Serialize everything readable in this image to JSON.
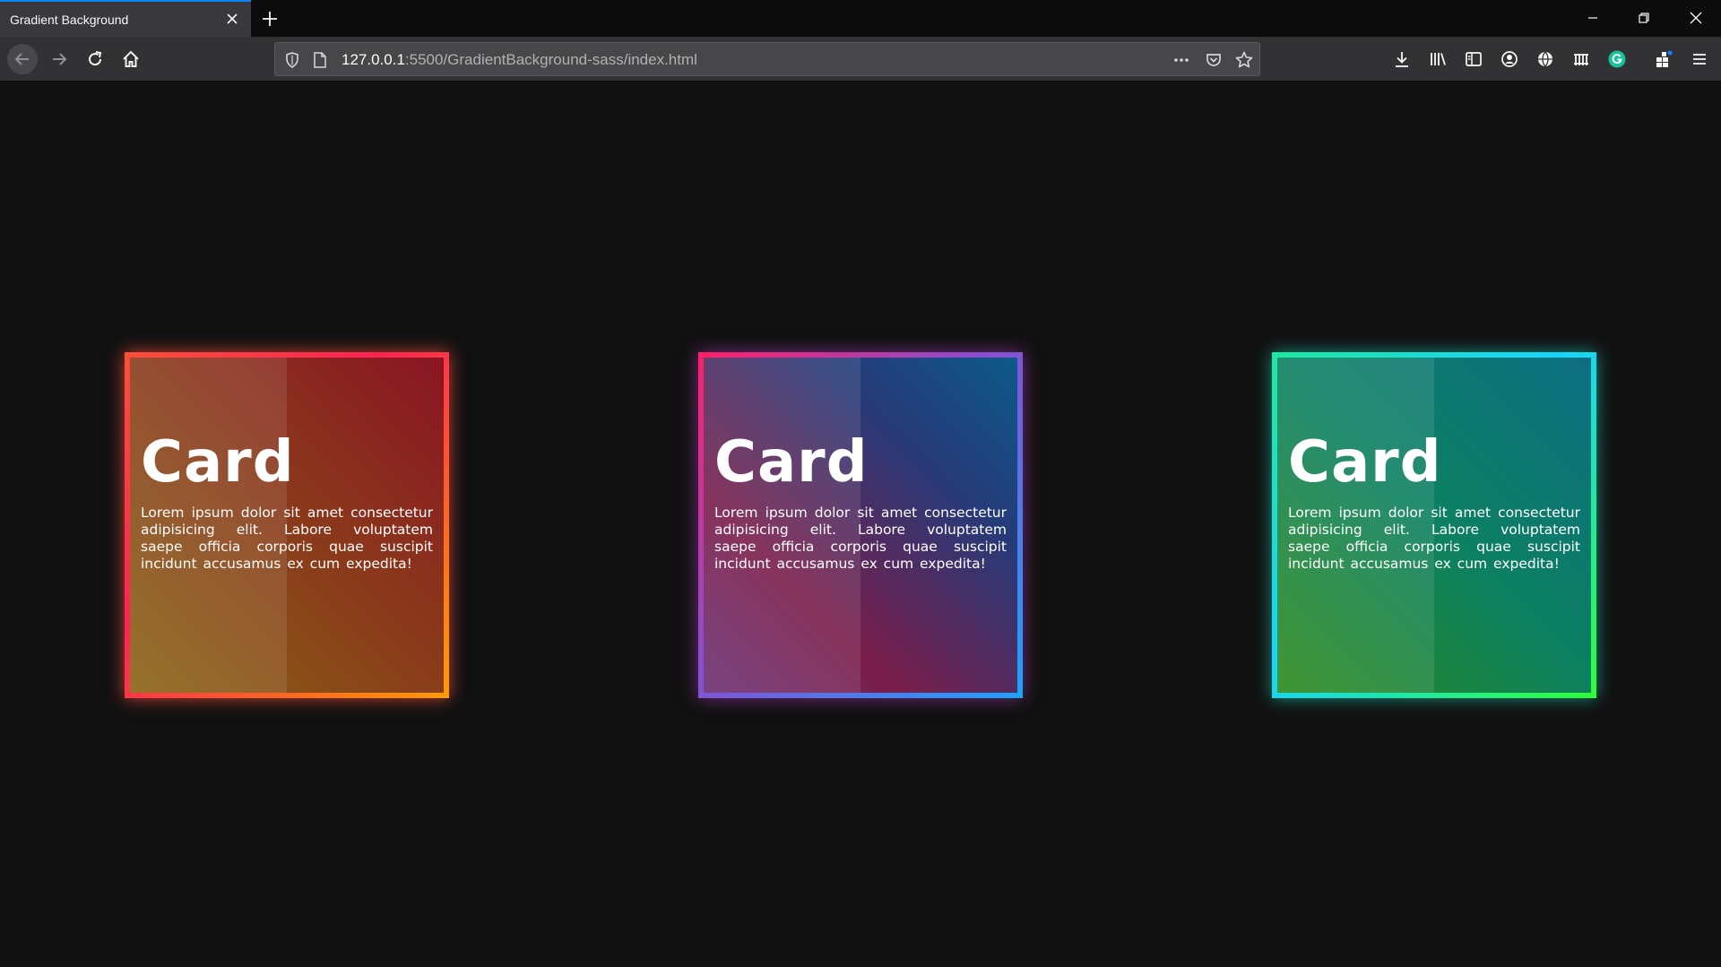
{
  "browser": {
    "tab_title": "Gradient Background",
    "url_host": "127.0.0.1",
    "url_path": ":5500/GradientBackground-sass/index.html",
    "accent_color": "#0a84ff"
  },
  "icons": {
    "tab_close": "close-icon",
    "new_tab": "plus-icon",
    "back": "arrow-left-icon",
    "forward": "arrow-right-icon",
    "reload": "reload-icon",
    "home": "home-icon",
    "shield": "shield-icon",
    "page": "page-icon",
    "more": "more-dots-icon",
    "pocket": "pocket-icon",
    "bookmark": "star-icon",
    "downloads": "download-icon",
    "library": "library-icon",
    "sidebar": "sidebar-icon",
    "account": "account-icon",
    "globe": "globe-icon",
    "extension_grid": "grid-extension-icon",
    "grammarly": "grammarly-icon",
    "extensions": "extensions-icon",
    "menu": "hamburger-menu-icon"
  },
  "cards": [
    {
      "title": "Card",
      "text": "Lorem ipsum dolor sit amet consectetur adipisicing elit. Labore voluptatem saepe officia corporis quae suscipit incidunt accusamus ex cum expedita!",
      "border_colors": [
        "#ff2255",
        "#ff9a00"
      ]
    },
    {
      "title": "Card",
      "text": "Lorem ipsum dolor sit amet consectetur adipisicing elit. Labore voluptatem saepe officia corporis quae suscipit incidunt accusamus ex cum expedita!",
      "border_colors": [
        "#ff1f6a",
        "#1aa3ff"
      ]
    },
    {
      "title": "Card",
      "text": "Lorem ipsum dolor sit amet consectetur adipisicing elit. Labore voluptatem saepe officia corporis quae suscipit incidunt accusamus ex cum expedita!",
      "border_colors": [
        "#17d4ff",
        "#2cff3a"
      ]
    }
  ]
}
